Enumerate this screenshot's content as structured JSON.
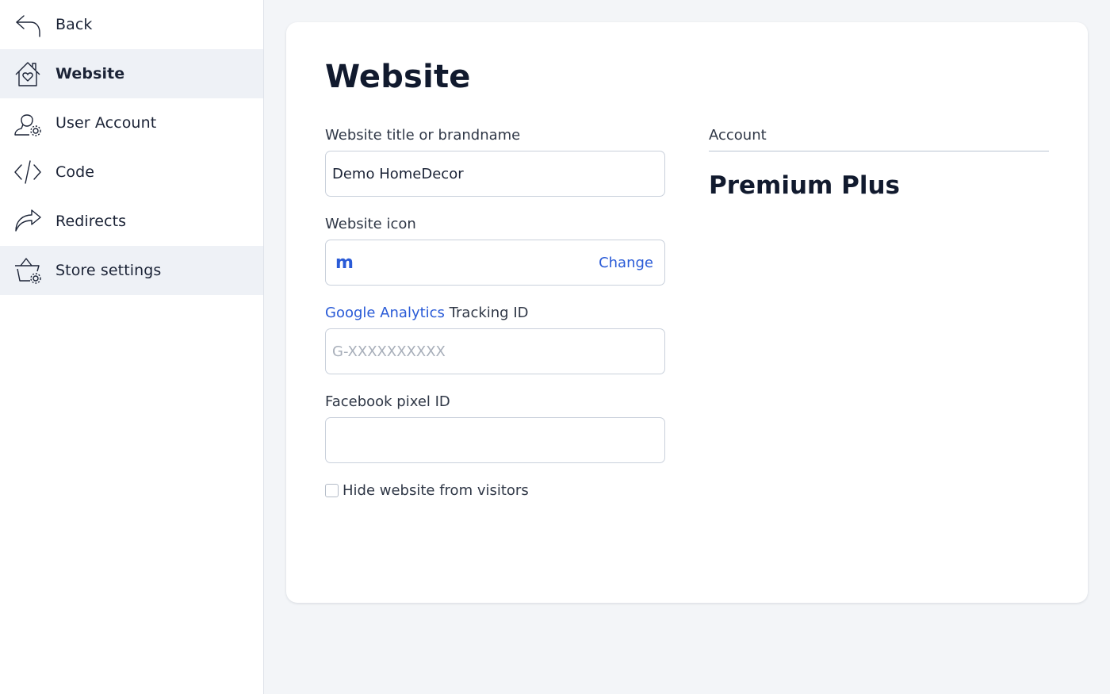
{
  "sidebar": {
    "items": [
      {
        "label": "Back",
        "icon": "back-arrow-icon"
      },
      {
        "label": "Website",
        "icon": "house-heart-icon",
        "active": true
      },
      {
        "label": "User Account",
        "icon": "user-gear-icon"
      },
      {
        "label": "Code",
        "icon": "code-icon"
      },
      {
        "label": "Redirects",
        "icon": "redirect-arrow-icon"
      },
      {
        "label": "Store settings",
        "icon": "basket-gear-icon"
      }
    ]
  },
  "main": {
    "title": "Website",
    "fields": {
      "title": {
        "label": "Website title or brandname",
        "value": "Demo HomeDecor"
      },
      "icon": {
        "label": "Website icon",
        "icon_glyph": "m",
        "change_label": "Change"
      },
      "analytics": {
        "label_link": "Google Analytics",
        "label_rest": " Tracking ID",
        "placeholder": "G-XXXXXXXXXX",
        "value": ""
      },
      "facebook": {
        "label": "Facebook pixel ID",
        "value": ""
      }
    },
    "hide_checkbox": {
      "label": "Hide website from visitors",
      "checked": false
    },
    "account": {
      "label": "Account",
      "plan": "Premium Plus"
    }
  },
  "colors": {
    "accent": "#2a5bd7",
    "text": "#1b2336",
    "background": "#f3f5f8",
    "active_nav": "#eef1f6"
  }
}
